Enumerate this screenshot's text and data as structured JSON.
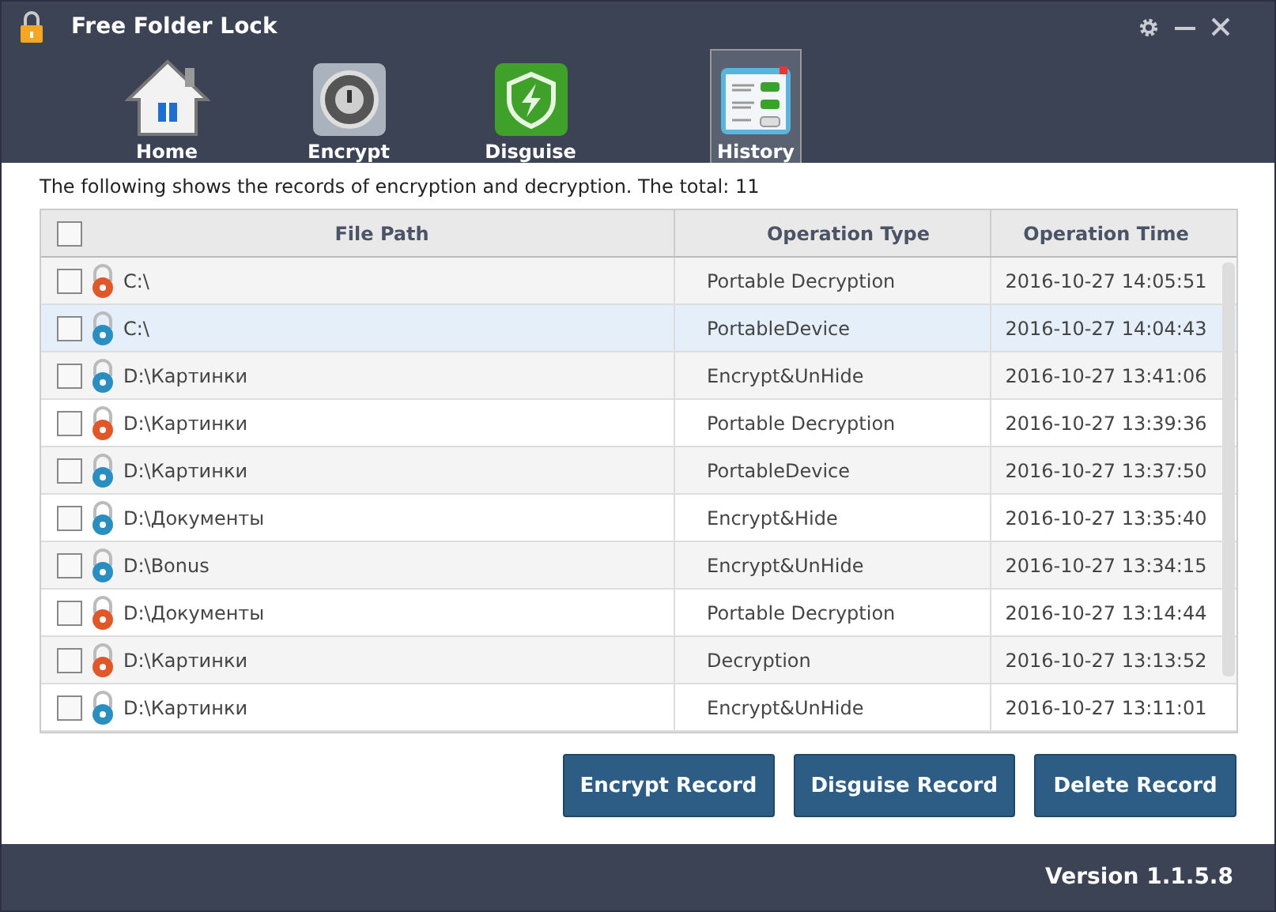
{
  "window": {
    "title": "Free Folder Lock"
  },
  "tabs": [
    {
      "label": "Home",
      "kind": "home",
      "selected": false
    },
    {
      "label": "Encrypt",
      "kind": "safe",
      "selected": false
    },
    {
      "label": "Disguise",
      "kind": "shield",
      "selected": false
    },
    {
      "label": "History",
      "kind": "list",
      "selected": true
    }
  ],
  "summary": "The following shows the records of encryption and decryption. The total: 11",
  "table": {
    "columns": [
      "File Path",
      "Operation Type",
      "Operation Time"
    ],
    "all_checked": false,
    "rows": [
      {
        "path": "C:\\",
        "type": "Portable Decryption",
        "time": "2016-10-27 14:05:51",
        "color": "#e0582a",
        "checked": false,
        "selected": false
      },
      {
        "path": "C:\\",
        "type": "PortableDevice",
        "time": "2016-10-27 14:04:43",
        "color": "#2a8fc0",
        "checked": false,
        "selected": true
      },
      {
        "path": "D:\\Картинки",
        "type": "Encrypt&UnHide",
        "time": "2016-10-27 13:41:06",
        "color": "#2a8fc0",
        "checked": false,
        "selected": false
      },
      {
        "path": "D:\\Картинки",
        "type": "Portable Decryption",
        "time": "2016-10-27 13:39:36",
        "color": "#e0582a",
        "checked": false,
        "selected": false
      },
      {
        "path": "D:\\Картинки",
        "type": "PortableDevice",
        "time": "2016-10-27 13:37:50",
        "color": "#2a8fc0",
        "checked": false,
        "selected": false
      },
      {
        "path": "D:\\Документы",
        "type": "Encrypt&Hide",
        "time": "2016-10-27 13:35:40",
        "color": "#2a8fc0",
        "checked": false,
        "selected": false
      },
      {
        "path": "D:\\Bonus",
        "type": "Encrypt&UnHide",
        "time": "2016-10-27 13:34:15",
        "color": "#2a8fc0",
        "checked": false,
        "selected": false
      },
      {
        "path": "D:\\Документы",
        "type": "Portable Decryption",
        "time": "2016-10-27 13:14:44",
        "color": "#e0582a",
        "checked": false,
        "selected": false
      },
      {
        "path": "D:\\Картинки",
        "type": "Decryption",
        "time": "2016-10-27 13:13:52",
        "color": "#e0582a",
        "checked": false,
        "selected": false
      },
      {
        "path": "D:\\Картинки",
        "type": "Encrypt&UnHide",
        "time": "2016-10-27 13:11:01",
        "color": "#2a8fc0",
        "checked": false,
        "selected": false
      }
    ]
  },
  "buttons": [
    "Encrypt Record",
    "Disguise Record",
    "Delete Record"
  ],
  "version": "Version 1.1.5.8"
}
